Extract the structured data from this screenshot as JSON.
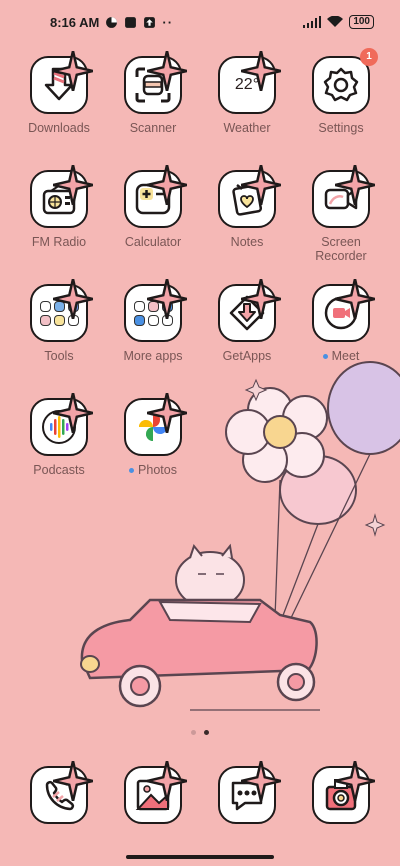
{
  "status_bar": {
    "time": "8:16 AM",
    "battery": "100",
    "icons": [
      "cloud-status-icon",
      "app-notification-icon",
      "upload-notification-icon",
      "more-dots-icon",
      "signal-icon",
      "wifi-icon",
      "battery-icon"
    ]
  },
  "apps": [
    {
      "label": "Downloads",
      "icon": "download-arrow-icon"
    },
    {
      "label": "Scanner",
      "icon": "scanner-icon"
    },
    {
      "label": "Weather",
      "icon": "weather-icon",
      "text": "22°"
    },
    {
      "label": "Settings",
      "icon": "gear-icon",
      "badge": "1"
    },
    {
      "label": "FM Radio",
      "icon": "radio-icon"
    },
    {
      "label": "Calculator",
      "icon": "calculator-icon"
    },
    {
      "label": "Notes",
      "icon": "notes-icon"
    },
    {
      "label": "Screen\nRecorder",
      "icon": "screen-recorder-icon"
    },
    {
      "label": "Tools",
      "icon": "folder-icon"
    },
    {
      "label": "More apps",
      "icon": "folder-icon"
    },
    {
      "label": "GetApps",
      "icon": "getapps-icon"
    },
    {
      "label": "Meet",
      "icon": "video-camera-icon",
      "new": true
    },
    {
      "label": "Podcasts",
      "icon": "podcasts-icon"
    },
    {
      "label": "Photos",
      "icon": "photos-pinwheel-icon",
      "new": true
    }
  ],
  "dock": [
    {
      "name": "phone",
      "icon": "phone-icon"
    },
    {
      "name": "gallery",
      "icon": "gallery-icon"
    },
    {
      "name": "messages",
      "icon": "messages-icon"
    },
    {
      "name": "camera",
      "icon": "camera-icon"
    }
  ],
  "pages": {
    "count": 2,
    "active": 2
  },
  "colors": {
    "background": "#f5b8b6",
    "icon_bg": "#ffffff",
    "outline": "#1f1a1a",
    "badge": "#f06a5a",
    "new_dot": "#4a90e2"
  }
}
